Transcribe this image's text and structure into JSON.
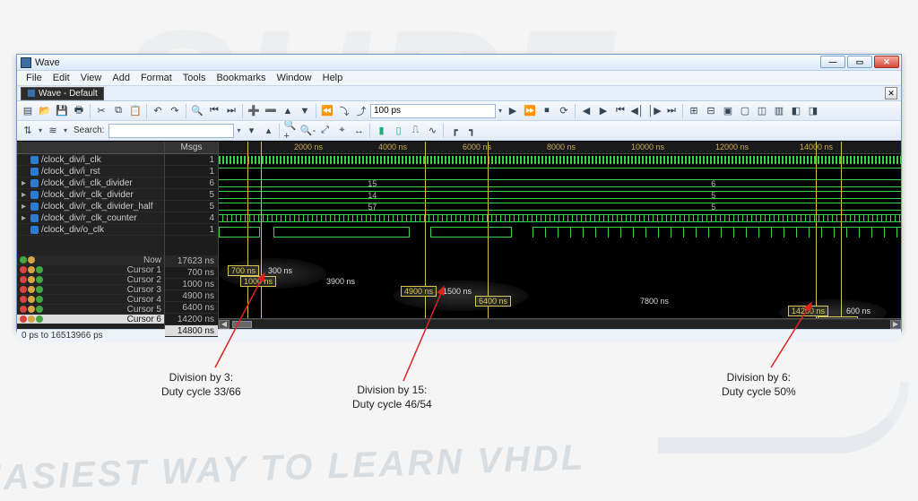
{
  "window": {
    "title": "Wave",
    "doc_tab": "Wave - Default"
  },
  "menu": [
    "File",
    "Edit",
    "View",
    "Add",
    "Format",
    "Tools",
    "Bookmarks",
    "Window",
    "Help"
  ],
  "toolbar": {
    "search_label": "Search:",
    "time_field": "100 ps"
  },
  "columns": {
    "signals_header": "",
    "msgs_header": "Msgs"
  },
  "signals": [
    {
      "name": "/clock_div/i_clk",
      "msg": "1"
    },
    {
      "name": "/clock_div/i_rst",
      "msg": "1"
    },
    {
      "name": "/clock_div/i_clk_divider",
      "msg": "6"
    },
    {
      "name": "/clock_div/r_clk_divider",
      "msg": "5"
    },
    {
      "name": "/clock_div/r_clk_divider_half",
      "msg": "5"
    },
    {
      "name": "/clock_div/r_clk_counter",
      "msg": "4"
    },
    {
      "name": "/clock_div/o_clk",
      "msg": "1"
    }
  ],
  "time": {
    "now_label": "Now",
    "now_value": "17623 ns",
    "ruler_ticks": [
      "2000 ns",
      "4000 ns",
      "6000 ns",
      "8000 ns",
      "10000 ns",
      "12000 ns",
      "14000 ns"
    ]
  },
  "cursors": [
    {
      "label": "Cursor 1",
      "value": "700 ns",
      "tag": "700 ns"
    },
    {
      "label": "Cursor 2",
      "value": "1000 ns",
      "tag": "1000 ns"
    },
    {
      "label": "Cursor 3",
      "value": "4900 ns",
      "tag": "4900 ns"
    },
    {
      "label": "Cursor 4",
      "value": "6400 ns",
      "tag": "6400 ns"
    },
    {
      "label": "Cursor 5",
      "value": "14200 ns",
      "tag": "14200 ns"
    },
    {
      "label": "Cursor 6",
      "value": "14800 ns",
      "tag": "14800 ns",
      "selected": true
    }
  ],
  "measurements": {
    "m12": "300 ns",
    "m23": "3900 ns",
    "m34": "1500 ns",
    "m45": "7800 ns",
    "m56": "600 ns"
  },
  "bus_values": {
    "divider_a": "15",
    "divider_b": "6",
    "rdiv_a": "14",
    "rdiv_b": "5",
    "half_a": "57",
    "half_b": "5"
  },
  "status_bar": "0 ps to 16513966 ps",
  "annotations": {
    "a1_l1": "Division by 3:",
    "a1_l2": "Duty cycle 33/66",
    "a2_l1": "Division by 15:",
    "a2_l2": "Duty cycle 46/54",
    "a3_l1": "Division by 6:",
    "a3_l2": "Duty cycle 50%"
  },
  "watermark": {
    "top": "SURF",
    "bottom": "E EASIEST WAY TO LEARN VHDL"
  },
  "chart_data": {
    "type": "timing-diagram",
    "x_unit": "ns",
    "x_range_ps": [
      0,
      16513966
    ],
    "now_ns": 17623,
    "signals": [
      {
        "name": "/clock_div/i_clk",
        "kind": "clock"
      },
      {
        "name": "/clock_div/i_rst",
        "kind": "bit",
        "value_shown": 1
      },
      {
        "name": "/clock_div/i_clk_divider",
        "kind": "bus",
        "segments": [
          {
            "value": 15
          },
          {
            "value": 6
          }
        ]
      },
      {
        "name": "/clock_div/r_clk_divider",
        "kind": "bus",
        "segments": [
          {
            "value": 14
          },
          {
            "value": 5
          }
        ]
      },
      {
        "name": "/clock_div/r_clk_divider_half",
        "kind": "bus",
        "segments": [
          {
            "value": 57
          },
          {
            "value": 5
          }
        ]
      },
      {
        "name": "/clock_div/r_clk_counter",
        "kind": "bus"
      },
      {
        "name": "/clock_div/o_clk",
        "kind": "bit"
      }
    ],
    "cursors_ns": [
      700,
      1000,
      4900,
      6400,
      14200,
      14800
    ],
    "deltas_ns": {
      "c1_c2": 300,
      "c2_c3": 3900,
      "c3_c4": 1500,
      "c4_c5": 7800,
      "c5_c6": 600
    },
    "annotations": [
      {
        "text": "Division by 3: Duty cycle 33/66",
        "cursor_pair": [
          1,
          2
        ]
      },
      {
        "text": "Division by 15: Duty cycle 46/54",
        "cursor_pair": [
          3,
          4
        ]
      },
      {
        "text": "Division by 6: Duty cycle 50%",
        "cursor_pair": [
          5,
          6
        ]
      }
    ]
  }
}
